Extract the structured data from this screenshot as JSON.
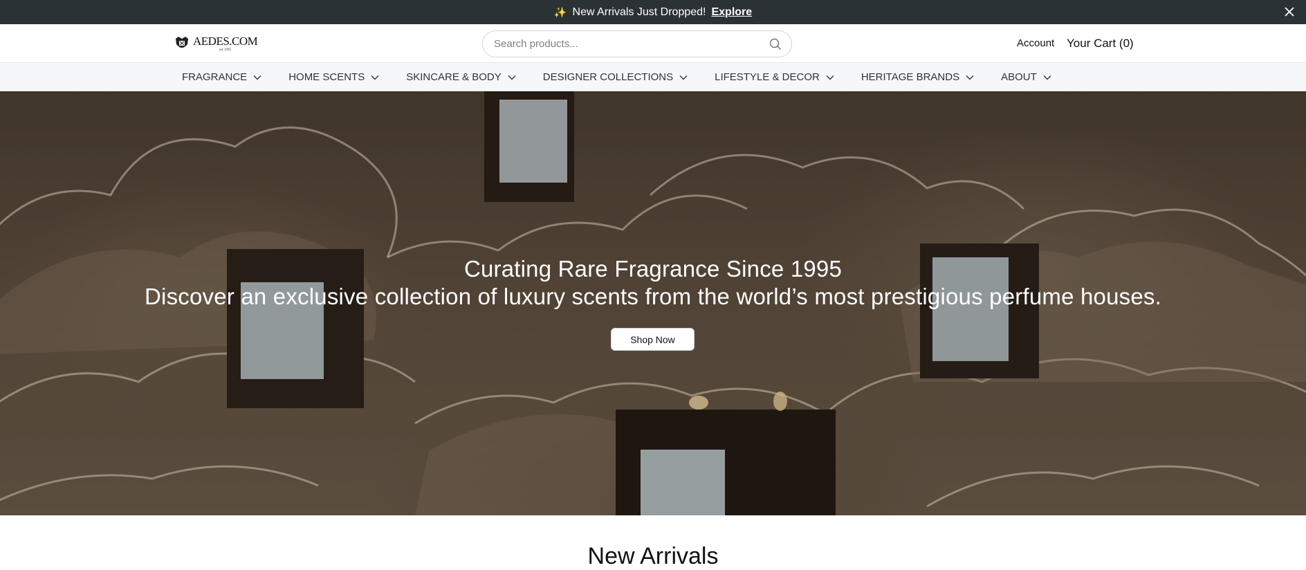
{
  "announcement": {
    "text": "New Arrivals Just Dropped!",
    "link": "Explore",
    "icon": "sparkle-icon"
  },
  "header": {
    "logo_name": "AEDES.COM",
    "logo_est": "est 1995",
    "search_placeholder": "Search products...",
    "account_label": "Account",
    "cart_label": "Your Cart (0)"
  },
  "nav": {
    "items": [
      {
        "label": "FRAGRANCE"
      },
      {
        "label": "HOME SCENTS"
      },
      {
        "label": "SKINCARE & BODY"
      },
      {
        "label": "DESIGNER COLLECTIONS"
      },
      {
        "label": "LIFESTYLE & DECOR"
      },
      {
        "label": "HERITAGE BRANDS"
      },
      {
        "label": "ABOUT"
      }
    ]
  },
  "hero": {
    "title": "Curating Rare Fragrance Since 1995",
    "subtitle": "Discover an exclusive collection of luxury scents from the world’s most prestigious perfume houses.",
    "cta": "Shop Now"
  },
  "section": {
    "title": "New Arrivals"
  },
  "colors": {
    "announce_bg": "#2b3236",
    "nav_bg": "#f6f7f9",
    "hero_tone": "#5e4e3e"
  }
}
